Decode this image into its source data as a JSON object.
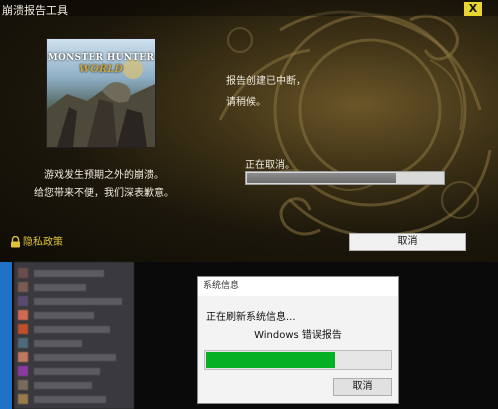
{
  "crash_window": {
    "title": "崩溃报告工具",
    "close_label": "X",
    "cover": {
      "title": "MONSTER HUNTER",
      "subtitle": "WORLD"
    },
    "apology_line1": "游戏发生预期之外的崩溃。",
    "apology_line2": "给您带来不便，我们深表歉意。",
    "status_line1": "报告创建已中断，",
    "status_line2": "请稍候。",
    "progress_label": "正在取消。",
    "progress": 0.76,
    "privacy_label": "隐私政策",
    "cancel_label": "取消",
    "accent_color": "#e0c23a"
  },
  "desktop": {
    "taskbar_color": "#1e73c8",
    "list_item_colors": [
      "#6b4b4b",
      "#7a5a52",
      "#5a4a70",
      "#d06a52",
      "#c0502a",
      "#4d6a78",
      "#c07860",
      "#8a3aa0",
      "#7a6a5a",
      "#9a7a4a"
    ]
  },
  "sysinfo_dialog": {
    "title": "系统信息",
    "status": "正在刷新系统信息...",
    "heading": "Windows 错误报告",
    "progress": 0.7,
    "progress_color": "#06b025",
    "cancel_label": "取消"
  }
}
